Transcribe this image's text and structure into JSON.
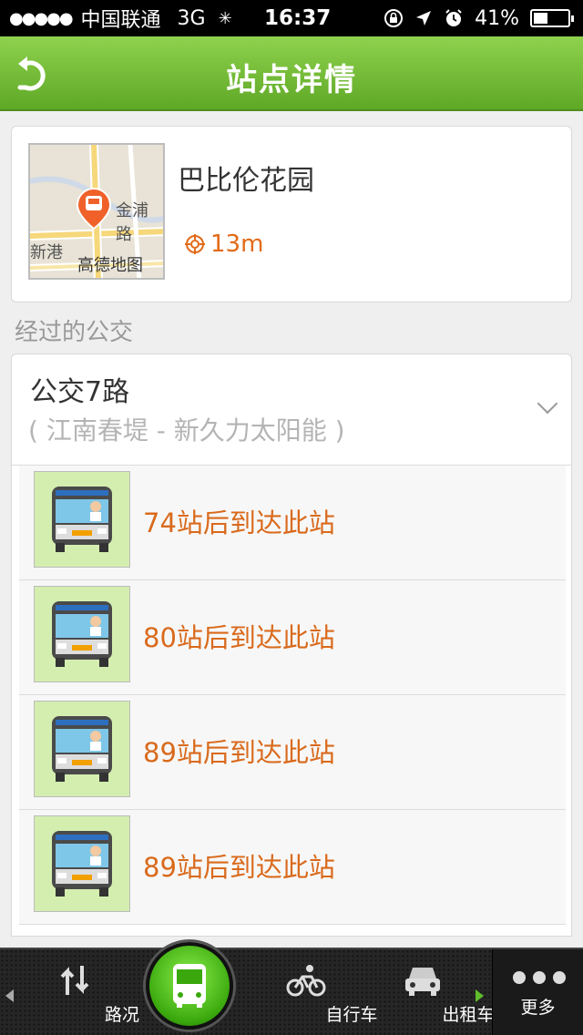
{
  "status_bar": {
    "signal": "●●●●●",
    "carrier": "中国联通",
    "network": "3G",
    "time": "16:37",
    "battery": "41%",
    "battery_level": 0.41
  },
  "header": {
    "title": "站点详情"
  },
  "station": {
    "name": "巴比伦花园",
    "distance": "13m",
    "map": {
      "road_label": "金浦路",
      "place_label": "新港",
      "logo": "高德地图"
    }
  },
  "passing_buses_label": "经过的公交",
  "route": {
    "name": "公交7路",
    "direction": "( 江南春堤 - 新久力太阳能 )"
  },
  "arrivals": [
    {
      "text": "74站后到达此站"
    },
    {
      "text": "80站后到达此站"
    },
    {
      "text": "89站后到达此站"
    },
    {
      "text": "89站后到达此站"
    }
  ],
  "tabbar": {
    "traffic": "路况",
    "bike": "自行车",
    "taxi": "出租车",
    "more": "更多"
  },
  "colors": {
    "nav_green": "#6fbb33",
    "accent_orange": "#d96a1c",
    "tab_bg": "#262626"
  }
}
